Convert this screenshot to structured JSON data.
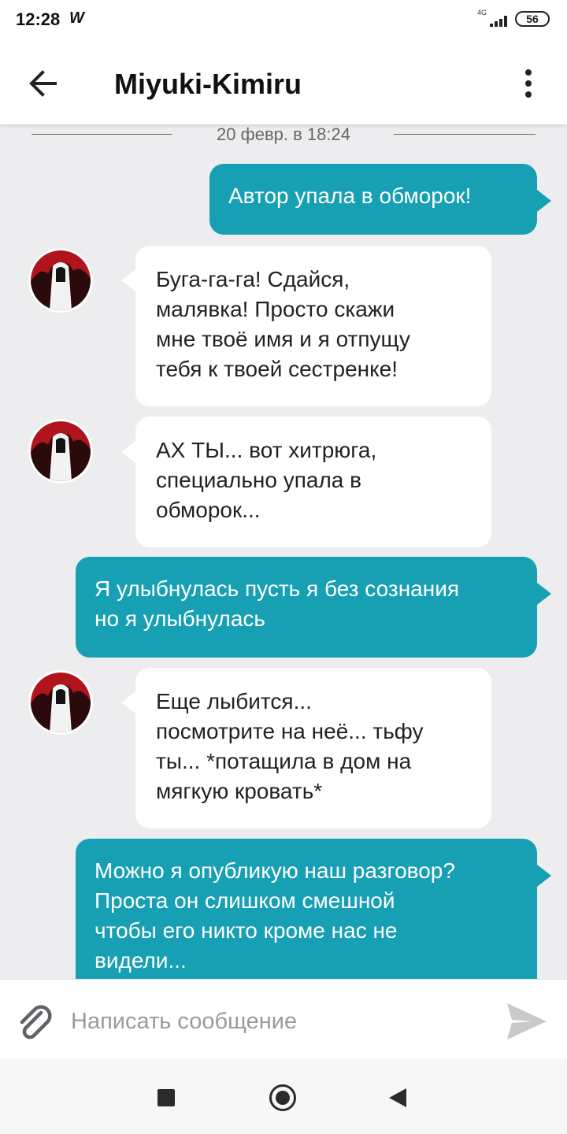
{
  "status_bar": {
    "time": "12:28",
    "app_indicator": "W",
    "network": "4G",
    "battery": "56"
  },
  "header": {
    "back_icon": "arrow-left-icon",
    "title": "Miyuki-Kimiru",
    "menu_icon": "more-vertical-icon"
  },
  "chat": {
    "date_separator": "20 февр. в 18:24",
    "messages": [
      {
        "side": "out",
        "lines": [
          "Автор упала в обморок!"
        ]
      },
      {
        "side": "in",
        "lines": [
          "Буга-га-га! Сдайся,",
          "малявка! Просто скажи",
          "мне твоё имя и я отпущу",
          "тебя к твоей сестренке!"
        ]
      },
      {
        "side": "in",
        "lines": [
          "АХ ТЫ... вот хитрюга,",
          "специально упала в",
          "обморок..."
        ]
      },
      {
        "side": "out",
        "lines": [
          "Я улыбнулась пусть я без сознания",
          "но я улыбнулась"
        ]
      },
      {
        "side": "in",
        "lines": [
          "Еще лыбится...",
          "посмотрите на неё... тьфу",
          "ты... *потащила в дом на",
          "мягкую кровать*"
        ]
      },
      {
        "side": "out",
        "lines": [
          "Можно я опубликую наш разговор?",
          "Проста он слишком смешной",
          "чтобы его никто кроме нас не",
          "видели..."
        ]
      }
    ]
  },
  "composer": {
    "attach_icon": "paperclip-icon",
    "placeholder": "Написать сообщение",
    "value": "",
    "send_icon": "send-icon"
  },
  "navbar": {
    "recent_icon": "square-recents-icon",
    "home_icon": "circle-home-icon",
    "back_icon": "triangle-back-icon"
  },
  "colors": {
    "accent": "#17a0b4",
    "chat_background": "#ededf0",
    "incoming_bubble": "#ffffff"
  }
}
